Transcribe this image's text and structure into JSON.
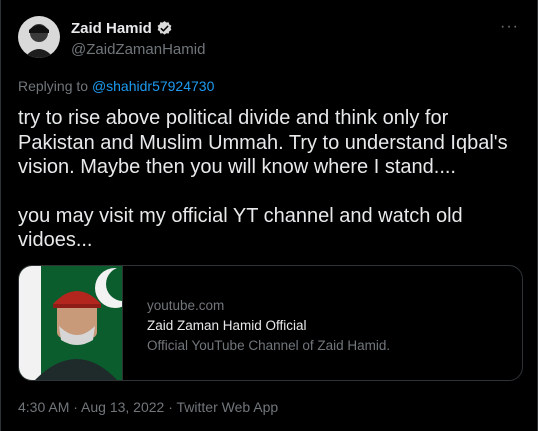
{
  "author": {
    "display_name": "Zaid Hamid",
    "handle": "@ZaidZamanHamid"
  },
  "more_label": "···",
  "reply_context": {
    "prefix": "Replying to",
    "mention": "@shahidr57924730"
  },
  "tweet": {
    "paragraphs": [
      "try to rise above political divide and think only for Pakistan and Muslim Ummah. Try to understand Iqbal's vision. Maybe then you will know where I stand....",
      "you may visit my official YT channel and watch old vidoes..."
    ]
  },
  "link_card": {
    "domain": "youtube.com",
    "title": "Zaid Zaman Hamid Official",
    "description": "Official YouTube Channel of Zaid Hamid."
  },
  "meta": {
    "time_date": "4:30 AM · Aug 13, 2022 · Twitter Web App"
  },
  "colors": {
    "background": "#000000",
    "text": "#e7e9ea",
    "secondary": "#71767b",
    "accent": "#1d9bf0",
    "border": "#2f3336"
  }
}
